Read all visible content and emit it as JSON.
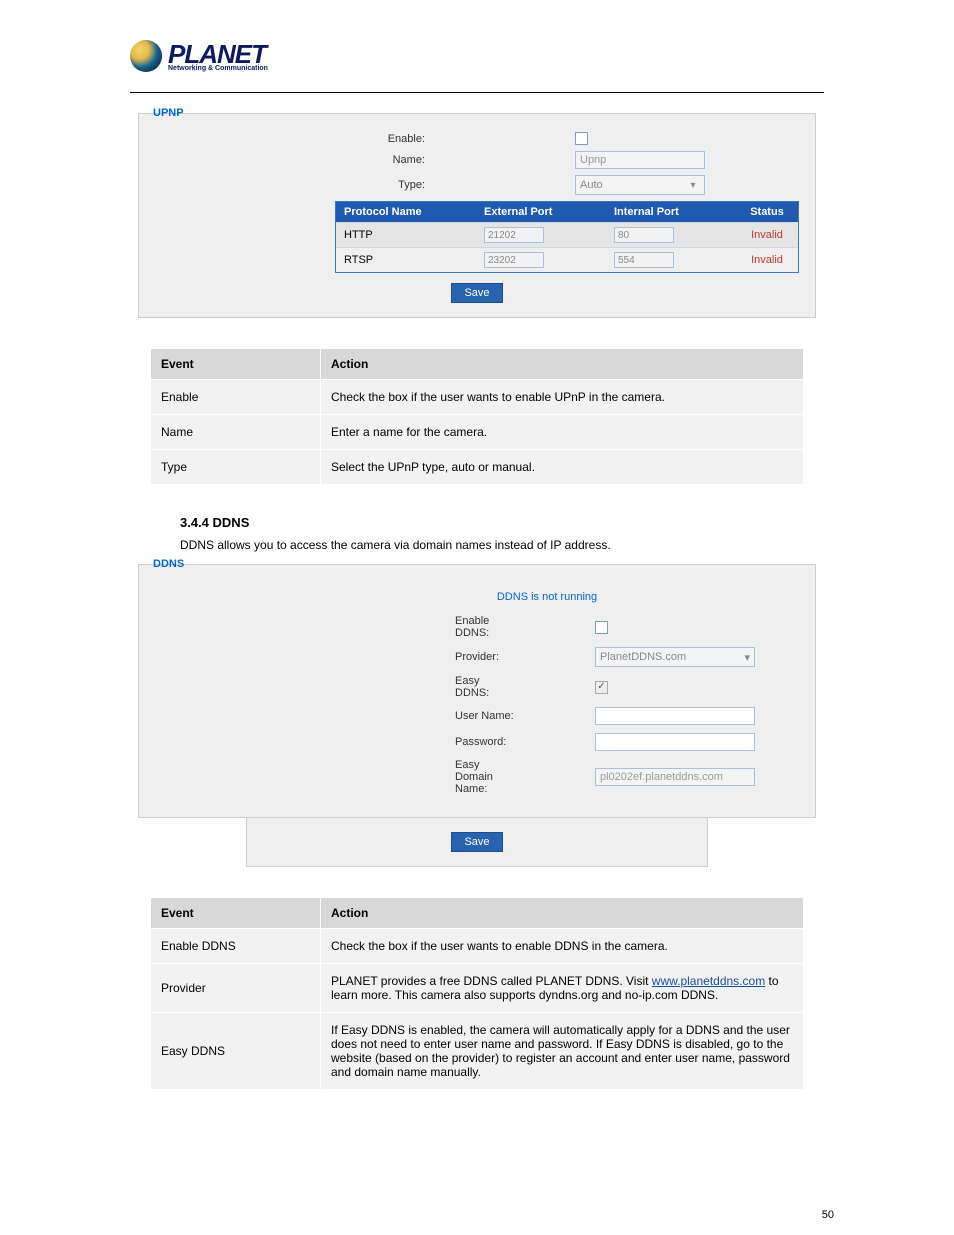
{
  "logo": {
    "word": "PLANET",
    "tag": "Networking & Communication"
  },
  "page_number": "50",
  "upnp": {
    "legend": "UPNP",
    "fields": {
      "enable_label": "Enable:",
      "name_label": "Name:",
      "name_value": "Upnp",
      "type_label": "Type:",
      "type_value": "Auto"
    },
    "cols": {
      "proto": "Protocol Name",
      "ext": "External Port",
      "int": "Internal Port",
      "status": "Status"
    },
    "rows": [
      {
        "proto": "HTTP",
        "ext": "21202",
        "int": "80",
        "status": "Invalid"
      },
      {
        "proto": "RTSP",
        "ext": "23202",
        "int": "554",
        "status": "Invalid"
      }
    ],
    "save": "Save",
    "desc": {
      "head_event": "Event",
      "head_action": "Action",
      "rows": [
        {
          "k": "Enable",
          "v": "Check the box if the user wants to enable UPnP in the camera."
        },
        {
          "k": "Name",
          "v": "Enter a name for the camera."
        },
        {
          "k": "Type",
          "v": "Select the UPnP type, auto or manual."
        }
      ]
    }
  },
  "ddns_section": {
    "heading": "3.4.4 DDNS",
    "intro": "DDNS allows you to access the camera via domain names instead of IP address.",
    "legend": "DDNS",
    "status": "DDNS is not running",
    "fields": {
      "enable_label": "Enable DDNS:",
      "provider_label": "Provider:",
      "provider_value": "PlanetDDNS.com",
      "easy_ddns_label": "Easy DDNS:",
      "user_label": "User Name:",
      "pass_label": "Password:",
      "easy_domain_label": "Easy Domain Name:",
      "easy_domain_value": "pl0202ef.planetddns.com"
    },
    "save": "Save",
    "desc": {
      "head_event": "Event",
      "head_action": "Action",
      "rows": [
        {
          "k": "Enable DDNS",
          "v": "Check the box if the user wants to enable DDNS in the camera."
        },
        {
          "k": "Provider",
          "v_prefix": "PLANET provides a free DDNS called PLANET DDNS. Visit ",
          "v_link_text": "www.planetddns.com",
          "v_suffix": " to learn more. This camera also supports dyndns.org and no-ip.com DDNS."
        },
        {
          "k": "Easy DDNS",
          "v": "If Easy DDNS is enabled, the camera will automatically apply for a DDNS and the user does not need to enter user name and password. If Easy DDNS is disabled, go to the website (based on the provider) to register an account and enter user name, password and domain name manually."
        }
      ]
    }
  }
}
